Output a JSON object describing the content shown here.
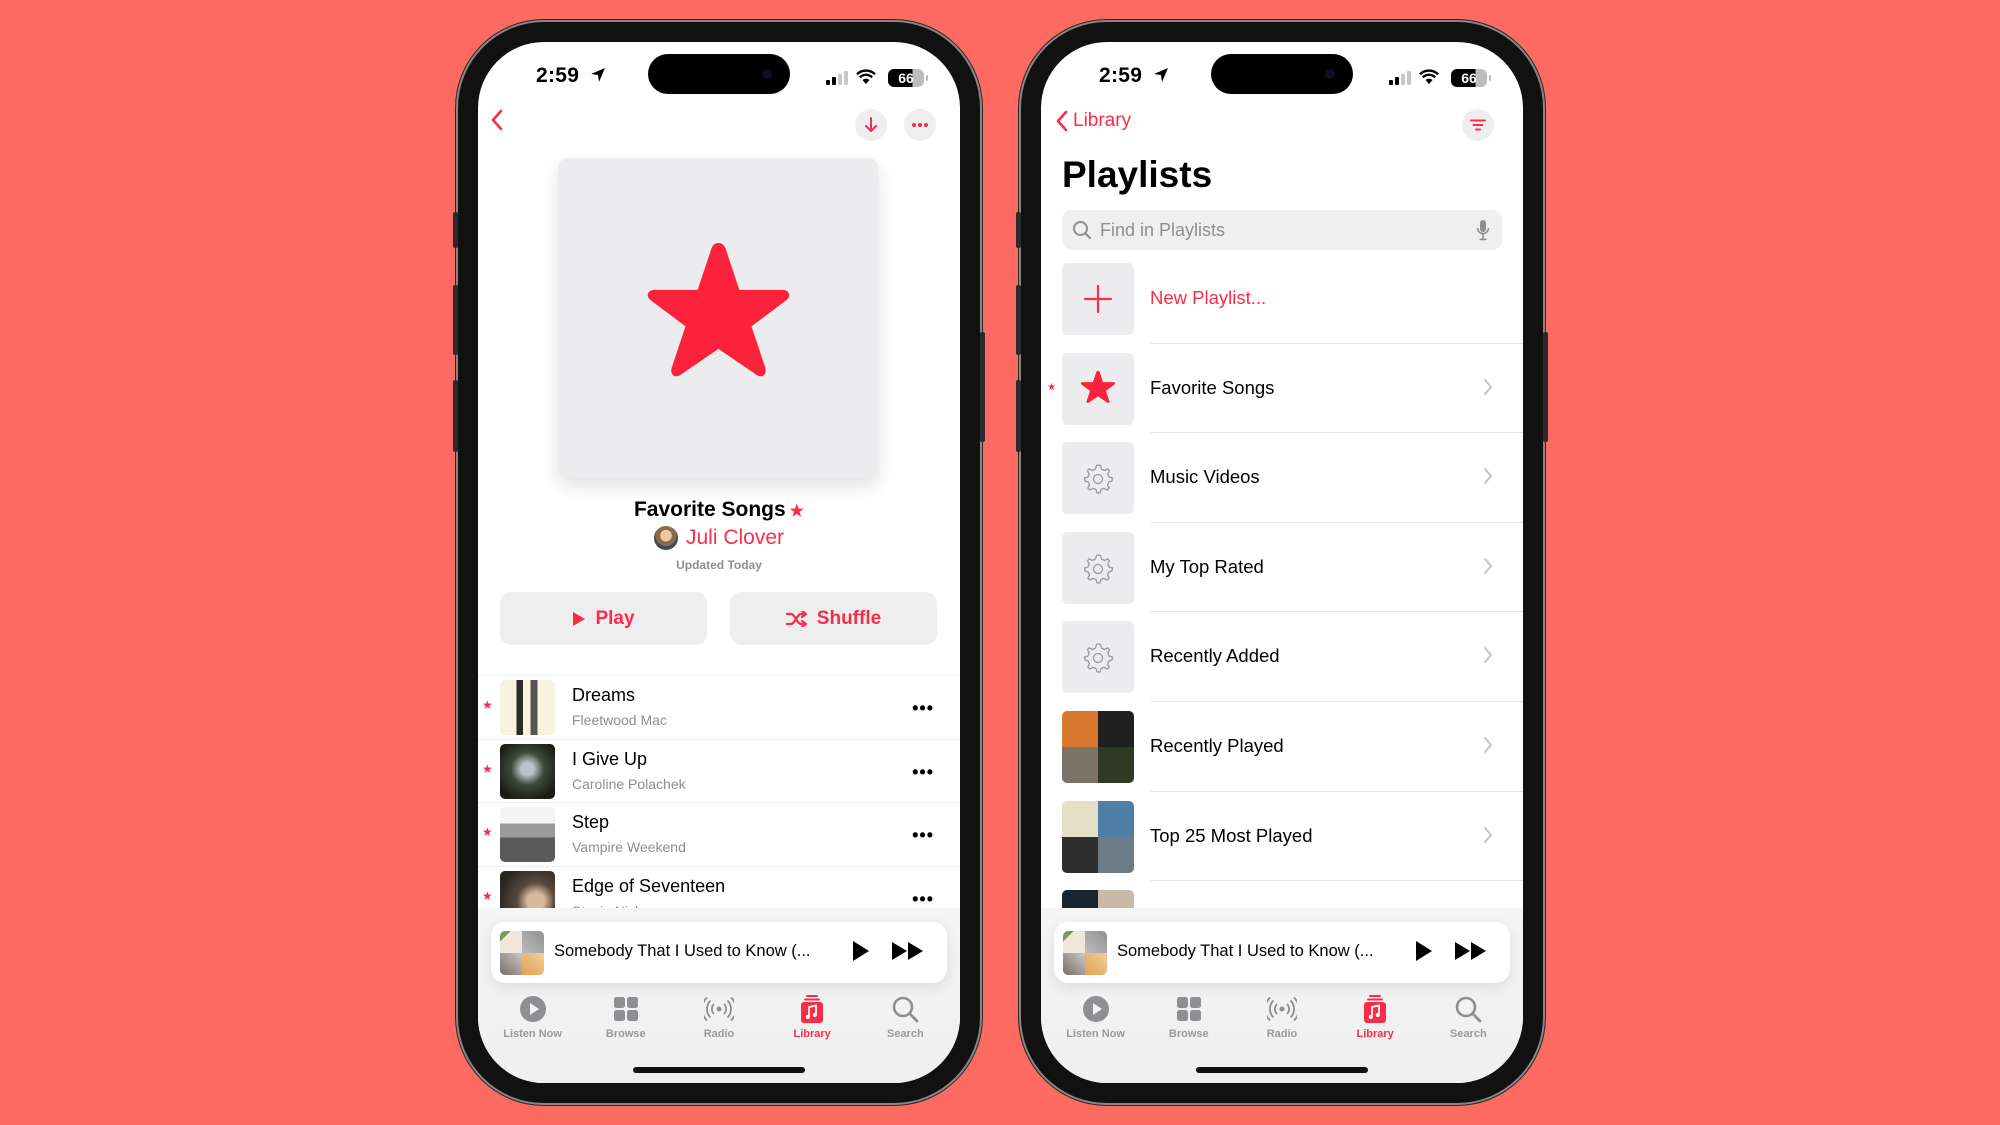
{
  "background_color": "#fd6a61",
  "accent_color": "#fa2d48",
  "left_phone": {
    "status": {
      "time": "2:59",
      "battery": "66"
    },
    "nav": {
      "back_icon": "chevron-left-icon",
      "download_icon": "arrow-down-icon",
      "more_icon": "ellipsis-icon"
    },
    "playlist": {
      "artwork_icon": "star-icon",
      "title": "Favorite Songs",
      "title_badge": "★",
      "curator": "Juli Clover",
      "updated": "Updated Today"
    },
    "actions": {
      "play_label": "Play",
      "shuffle_label": "Shuffle"
    },
    "songs": [
      {
        "title": "Dreams",
        "artist": "Fleetwood Mac",
        "favorite": "★",
        "more": "•••"
      },
      {
        "title": "I Give Up",
        "artist": "Caroline Polachek",
        "favorite": "★",
        "more": "•••"
      },
      {
        "title": "Step",
        "artist": "Vampire Weekend",
        "favorite": "★",
        "more": "•••"
      },
      {
        "title": "Edge of Seventeen",
        "artist": "Stevie Nicks",
        "favorite": "★",
        "more": "•••"
      }
    ],
    "mini_player": {
      "title": "Somebody That I Used to Know (..."
    },
    "tabs": [
      {
        "label": "Listen Now",
        "icon": "play-circle-icon"
      },
      {
        "label": "Browse",
        "icon": "grid-icon"
      },
      {
        "label": "Radio",
        "icon": "radio-waves-icon"
      },
      {
        "label": "Library",
        "icon": "music-library-icon",
        "active": true
      },
      {
        "label": "Search",
        "icon": "search-icon"
      }
    ]
  },
  "right_phone": {
    "status": {
      "time": "2:59",
      "battery": "66"
    },
    "nav": {
      "back_label": "Library",
      "sort_icon": "sort-lines-icon"
    },
    "title": "Playlists",
    "search": {
      "placeholder": "Find in Playlists",
      "value": ""
    },
    "playlists": [
      {
        "label": "New Playlist...",
        "icon": "plus-icon",
        "type": "action"
      },
      {
        "label": "Favorite Songs",
        "icon": "star-icon",
        "favorite": "★"
      },
      {
        "label": "Music Videos",
        "icon": "gear-icon"
      },
      {
        "label": "My Top Rated",
        "icon": "gear-icon"
      },
      {
        "label": "Recently Added",
        "icon": "gear-icon"
      },
      {
        "label": "Recently Played",
        "icon": "album-collage"
      },
      {
        "label": "Top 25 Most Played",
        "icon": "album-collage"
      },
      {
        "label": "",
        "icon": "album-collage"
      }
    ],
    "mini_player": {
      "title": "Somebody That I Used to Know (..."
    },
    "tabs": [
      {
        "label": "Listen Now",
        "icon": "play-circle-icon"
      },
      {
        "label": "Browse",
        "icon": "grid-icon"
      },
      {
        "label": "Radio",
        "icon": "radio-waves-icon"
      },
      {
        "label": "Library",
        "icon": "music-library-icon",
        "active": true
      },
      {
        "label": "Search",
        "icon": "search-icon"
      }
    ]
  }
}
